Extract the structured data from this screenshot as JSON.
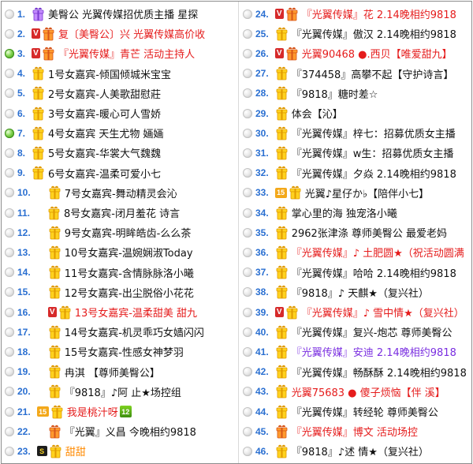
{
  "left": [
    {
      "n": "1.",
      "dot": "grey",
      "badge": "",
      "avatar": "purple",
      "name": "美臀公 光翼传媒招优质主播 星探",
      "color": "black"
    },
    {
      "n": "2.",
      "dot": "grey",
      "badge": "v",
      "avatar": "orange",
      "name": "复〔美臀公〕兴 光翼传媒高价收",
      "color": "red"
    },
    {
      "n": "3.",
      "dot": "green",
      "badge": "v",
      "avatar": "orange",
      "name": "『光翼传媒』青芒 活动主持人",
      "color": "red"
    },
    {
      "n": "4.",
      "dot": "grey",
      "badge": "",
      "avatar": "yellow",
      "name": "1号女嘉宾-倾国倾城米宝宝",
      "color": "black"
    },
    {
      "n": "5.",
      "dot": "grey",
      "badge": "",
      "avatar": "yellow",
      "name": "2号女嘉宾-人美歌甜慰莊",
      "color": "black"
    },
    {
      "n": "6.",
      "dot": "grey",
      "badge": "",
      "avatar": "yellow",
      "name": "3号女嘉宾-暖心可人雪娇",
      "color": "black"
    },
    {
      "n": "7.",
      "dot": "green",
      "badge": "",
      "avatar": "yellow",
      "name": "4号女嘉宾 天生尤物 婳婳",
      "color": "black"
    },
    {
      "n": "8.",
      "dot": "grey",
      "badge": "",
      "avatar": "yellow",
      "name": "5号女嘉宾-华裳大气魏魏",
      "color": "black"
    },
    {
      "n": "9.",
      "dot": "grey",
      "badge": "",
      "avatar": "yellow",
      "name": "6号女嘉宾-温柔可爱小七",
      "color": "black"
    },
    {
      "n": "10.",
      "dot": "grey",
      "badge": "",
      "avatar": "yellow",
      "name": "7号女嘉宾-舞动精灵会沁",
      "color": "black",
      "indent": 1
    },
    {
      "n": "11.",
      "dot": "grey",
      "badge": "",
      "avatar": "yellow",
      "name": "8号女嘉宾-闭月羞花 诗言",
      "color": "black",
      "indent": 1
    },
    {
      "n": "12.",
      "dot": "grey",
      "badge": "",
      "avatar": "yellow",
      "name": "9号女嘉宾-明眸皓齿-么么茶",
      "color": "black",
      "indent": 1
    },
    {
      "n": "13.",
      "dot": "grey",
      "badge": "",
      "avatar": "yellow",
      "name": "10号女嘉宾-温婉娴淑Today",
      "color": "black",
      "indent": 1
    },
    {
      "n": "14.",
      "dot": "grey",
      "badge": "",
      "avatar": "yellow",
      "name": "11号女嘉宾-含情脉脉洛小曦",
      "color": "black",
      "indent": 1
    },
    {
      "n": "15.",
      "dot": "grey",
      "badge": "",
      "avatar": "yellow",
      "name": "12号女嘉宾-出尘脱俗小花花",
      "color": "black",
      "indent": 1
    },
    {
      "n": "16.",
      "dot": "grey",
      "badge": "v",
      "avatar": "yellow",
      "name": "13号女嘉宾-温柔甜美 甜九",
      "color": "red",
      "indent": 1
    },
    {
      "n": "17.",
      "dot": "grey",
      "badge": "",
      "avatar": "yellow",
      "name": "14号女嘉宾-机灵乖巧女嫱闪闪",
      "color": "black",
      "indent": 1
    },
    {
      "n": "18.",
      "dot": "grey",
      "badge": "",
      "avatar": "yellow",
      "name": "15号女嘉宾-性感女神梦羽",
      "color": "black",
      "indent": 1
    },
    {
      "n": "19.",
      "dot": "grey",
      "badge": "",
      "avatar": "yellow",
      "name": "冉淇 【尊师美臀公】",
      "color": "black",
      "indent": 1
    },
    {
      "n": "20.",
      "dot": "grey",
      "badge": "",
      "avatar": "yellow",
      "name": "『9818』♪阿 止★场控组",
      "color": "black",
      "indent": 1
    },
    {
      "n": "21.",
      "dot": "grey",
      "badge": "15",
      "avatar": "yellow",
      "name": "我是桃汁呀",
      "color": "red",
      "lvl": "12"
    },
    {
      "n": "22.",
      "dot": "grey",
      "badge": "",
      "avatar": "orange",
      "name": "『光翼』义昌 今晚相约9818",
      "color": "black",
      "indent": 1
    },
    {
      "n": "23.",
      "dot": "grey",
      "badge": "s",
      "avatar": "yellow",
      "name": "甜甜",
      "color": "orange"
    }
  ],
  "right": [
    {
      "n": "24.",
      "dot": "grey",
      "badge": "v",
      "avatar": "orange",
      "name": "『光翼传媒』花 2.14晚相约9818",
      "color": "red"
    },
    {
      "n": "25.",
      "dot": "grey",
      "badge": "",
      "avatar": "yellow",
      "name": "『光翼传媒』傲汉 2.14晚相约9818",
      "color": "black"
    },
    {
      "n": "26.",
      "dot": "grey",
      "badge": "v",
      "avatar": "orange",
      "name": "光翼90468 ●.西贝【唯爱甜九】",
      "color": "red"
    },
    {
      "n": "27.",
      "dot": "grey",
      "badge": "",
      "avatar": "yellow",
      "name": "『374458』高攀不起【守护诗言】",
      "color": "black"
    },
    {
      "n": "28.",
      "dot": "grey",
      "badge": "",
      "avatar": "yellow",
      "name": "『9818』糖时差☆",
      "color": "black"
    },
    {
      "n": "29.",
      "dot": "grey",
      "badge": "",
      "avatar": "yellow",
      "name": "体会【沁】",
      "color": "black"
    },
    {
      "n": "30.",
      "dot": "grey",
      "badge": "",
      "avatar": "yellow",
      "name": "『光翼传媒』梓七：招募优质女主播",
      "color": "black"
    },
    {
      "n": "31.",
      "dot": "grey",
      "badge": "",
      "avatar": "yellow",
      "name": "『光翼传媒』w生：招募优质女主播",
      "color": "black"
    },
    {
      "n": "32.",
      "dot": "grey",
      "badge": "",
      "avatar": "yellow",
      "name": "『光翼传媒』夕焱 2.14晚相约9818",
      "color": "black"
    },
    {
      "n": "33.",
      "dot": "grey",
      "badge": "15",
      "avatar": "yellow",
      "name": "光翼♪星仔か♭【陪伴小七】",
      "color": "black"
    },
    {
      "n": "34.",
      "dot": "grey",
      "badge": "",
      "avatar": "yellow",
      "name": "掌心里的海 独宠洛小曦",
      "color": "black"
    },
    {
      "n": "35.",
      "dot": "grey",
      "badge": "",
      "avatar": "yellow",
      "name": "2962张津涤 尊师美臀公 最爱老妈",
      "color": "black"
    },
    {
      "n": "36.",
      "dot": "grey",
      "badge": "",
      "avatar": "yellow",
      "name": "『光翼传媒』♪ 土肥圆★（祝活动圆满",
      "color": "red"
    },
    {
      "n": "37.",
      "dot": "grey",
      "badge": "",
      "avatar": "yellow",
      "name": "『光翼传媒』哈哈 2.14晚相约9818",
      "color": "black"
    },
    {
      "n": "38.",
      "dot": "grey",
      "badge": "",
      "avatar": "yellow",
      "name": "『9818』♪ 天麒★（复兴社）",
      "color": "black"
    },
    {
      "n": "39.",
      "dot": "grey",
      "badge": "v",
      "avatar": "yellow",
      "name": "『光翼传媒』♪ 雪中情★（复兴社）",
      "color": "red"
    },
    {
      "n": "40.",
      "dot": "grey",
      "badge": "",
      "avatar": "yellow",
      "name": "『光翼传媒』复兴-炮芯 尊师美臀公",
      "color": "black"
    },
    {
      "n": "41.",
      "dot": "grey",
      "badge": "",
      "avatar": "yellow",
      "name": "『光翼传媒』安迪 2.14晚相约9818",
      "color": "purple"
    },
    {
      "n": "42.",
      "dot": "grey",
      "badge": "",
      "avatar": "yellow",
      "name": "『光翼传媒』畅酥酥 2.14晚相约9818",
      "color": "black"
    },
    {
      "n": "43.",
      "dot": "grey",
      "badge": "",
      "avatar": "yellow",
      "name": "光翼75683 ● 傻子烦恼【伴 溪】",
      "color": "red"
    },
    {
      "n": "44.",
      "dot": "grey",
      "badge": "",
      "avatar": "yellow",
      "name": "『光翼传媒』转经轮 尊师美臀公",
      "color": "black"
    },
    {
      "n": "45.",
      "dot": "grey",
      "badge": "",
      "avatar": "orange",
      "name": "『光翼传媒』博文 活动场控",
      "color": "red"
    },
    {
      "n": "46.",
      "dot": "grey",
      "badge": "",
      "avatar": "yellow",
      "name": "『9818』♪述 情★（复兴社）",
      "color": "black"
    }
  ],
  "icons": {
    "status_dot": "status-dot-icon",
    "avatar": "gift-avatar-icon",
    "vip": "vip-badge-icon",
    "level": "level-badge-icon"
  },
  "badge_text": {
    "v": "V",
    "15": "15",
    "s": "S"
  },
  "colors": {
    "number": "#2a6fd1",
    "name_default": "#111111",
    "name_red": "#e51c1c",
    "name_purple": "#7a2ee0",
    "name_orange": "#ff8a00",
    "vip_badge": "#d62a2a"
  }
}
